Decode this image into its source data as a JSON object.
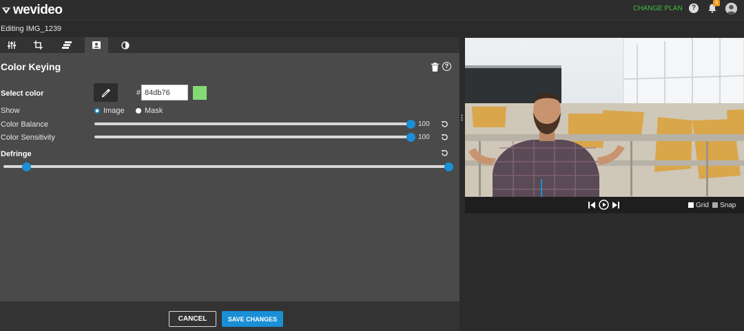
{
  "app": {
    "logo_text": "wevideo",
    "change_plan": "CHANGE PLAN",
    "help_glyph": "?",
    "notification_count": "3",
    "accent_color": "#1a8fd6",
    "plan_color": "#3fc03f"
  },
  "subheader": {
    "title": "Editing IMG_1239"
  },
  "tabs": [
    {
      "name": "adjust-tab",
      "icon": "sliders-icon"
    },
    {
      "name": "crop-tab",
      "icon": "crop-icon"
    },
    {
      "name": "layers-tab",
      "icon": "layers-icon"
    },
    {
      "name": "color-keying-tab",
      "icon": "portrait-icon",
      "active": true
    },
    {
      "name": "filters-tab",
      "icon": "contrast-icon"
    }
  ],
  "panel": {
    "title": "Color Keying",
    "help_glyph": "?",
    "select_color_label": "Select color",
    "hash": "#",
    "hex_value": "84db76",
    "swatch_color": "#84db76",
    "show_label": "Show",
    "show_options": [
      {
        "label": "Image",
        "selected": true
      },
      {
        "label": "Mask",
        "selected": false
      }
    ],
    "color_balance": {
      "label": "Color Balance",
      "value": "100",
      "max": 100
    },
    "color_sensitivity": {
      "label": "Color Sensitivity",
      "value": "100",
      "max": 100
    },
    "defringe": {
      "label": "Defringe",
      "range_low": 0.05,
      "range_high": 1.0
    }
  },
  "footer": {
    "cancel_label": "CANCEL",
    "save_label": "SAVE CHANGES"
  },
  "player": {
    "grid_label": "Grid",
    "snap_label": "Snap",
    "grid_checked": false,
    "snap_checked": true
  }
}
